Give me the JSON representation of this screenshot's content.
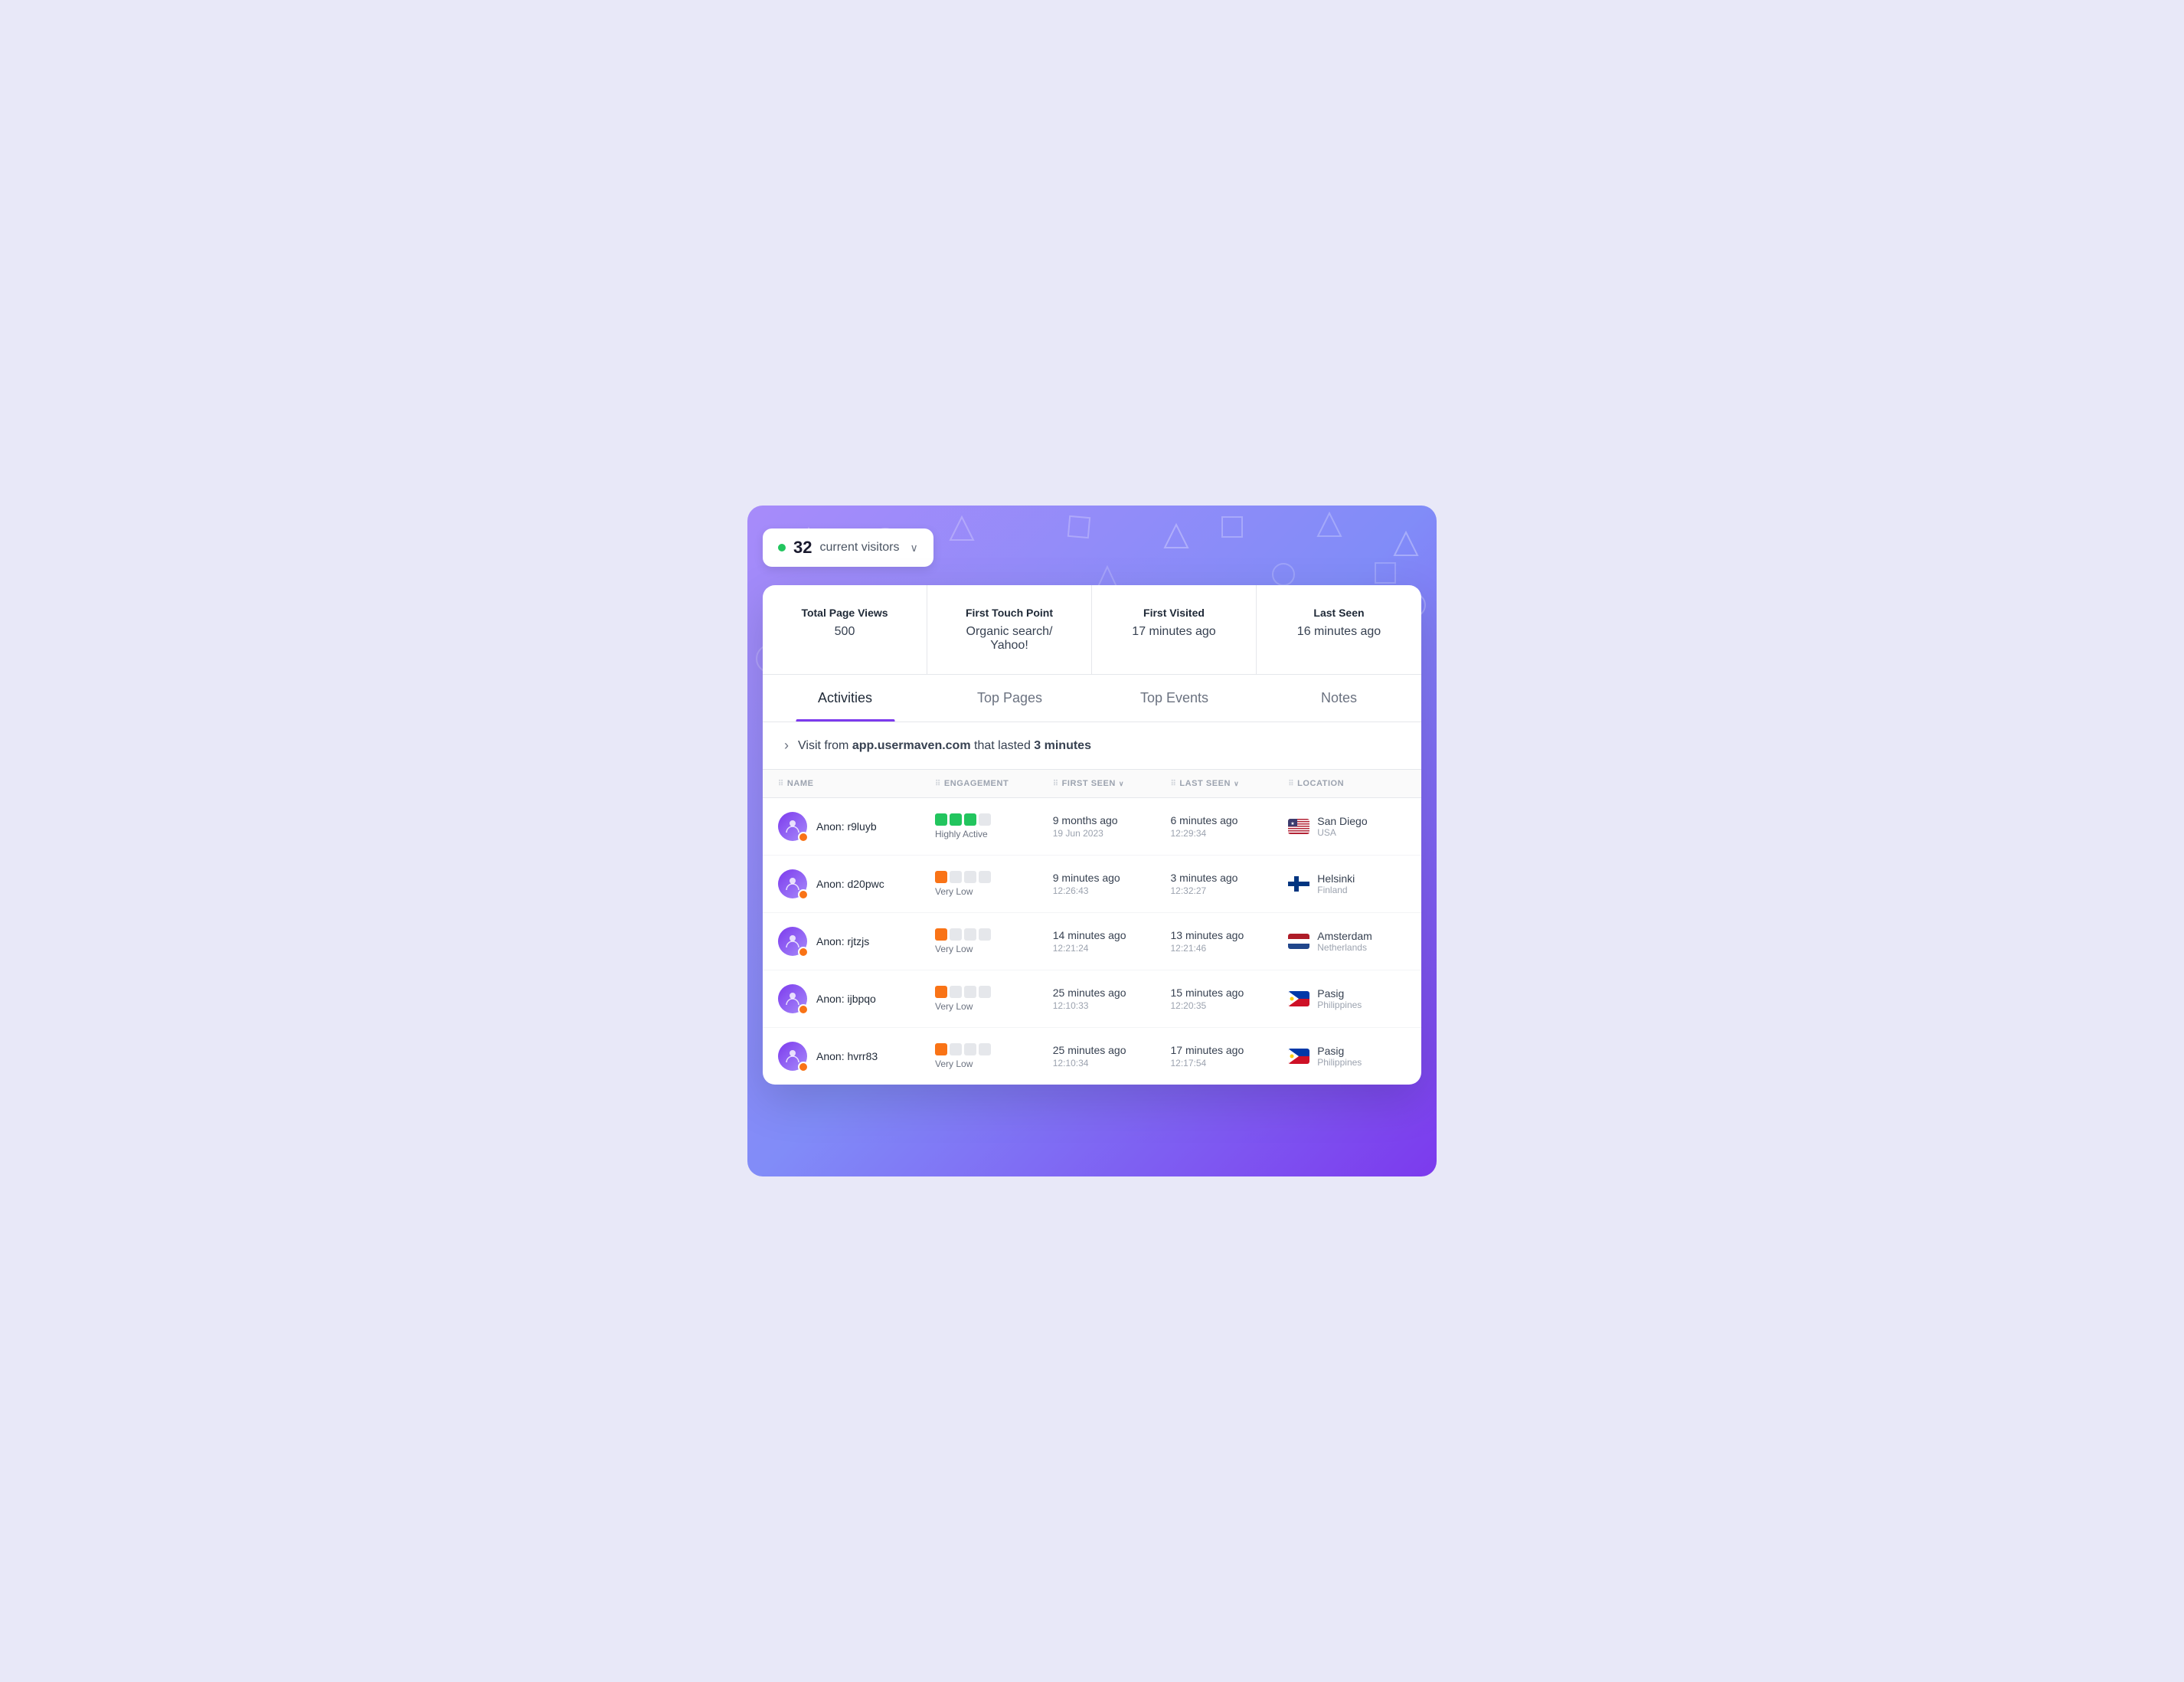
{
  "visitor_pill": {
    "count": "32",
    "label": "current visitors",
    "chevron": "∨"
  },
  "stats": [
    {
      "label": "Total Page Views",
      "value": "500"
    },
    {
      "label": "First Touch Point",
      "value": "Organic search/ Yahoo!"
    },
    {
      "label": "First Visited",
      "value": "17 minutes ago"
    },
    {
      "label": "Last Seen",
      "value": "16 minutes ago"
    }
  ],
  "tabs": [
    {
      "id": "activities",
      "label": "Activities",
      "active": true
    },
    {
      "id": "top-pages",
      "label": "Top Pages",
      "active": false
    },
    {
      "id": "top-events",
      "label": "Top Events",
      "active": false
    },
    {
      "id": "notes",
      "label": "Notes",
      "active": false
    }
  ],
  "visit_banner": {
    "text_prefix": "Visit from ",
    "domain": "app.usermaven.com",
    "text_middle": " that lasted ",
    "duration": "3 minutes"
  },
  "table": {
    "columns": [
      {
        "id": "name",
        "label": "NAME",
        "sortable": false
      },
      {
        "id": "engagement",
        "label": "ENGAGEMENT",
        "sortable": false
      },
      {
        "id": "first_seen",
        "label": "FIRST SEEN",
        "sortable": true
      },
      {
        "id": "last_seen",
        "label": "LAST SEEN",
        "sortable": true
      },
      {
        "id": "location",
        "label": "LOCATION",
        "sortable": false
      }
    ],
    "rows": [
      {
        "name": "Anon: r9luyb",
        "engagement_level": "highly_active",
        "engagement_label": "Highly Active",
        "first_seen_main": "9 months ago",
        "first_seen_sub": "19 Jun 2023",
        "last_seen_main": "6 minutes ago",
        "last_seen_sub": "12:29:34",
        "city": "San Diego",
        "country": "USA",
        "flag": "usa"
      },
      {
        "name": "Anon: d20pwc",
        "engagement_level": "very_low",
        "engagement_label": "Very Low",
        "first_seen_main": "9 minutes ago",
        "first_seen_sub": "12:26:43",
        "last_seen_main": "3 minutes ago",
        "last_seen_sub": "12:32:27",
        "city": "Helsinki",
        "country": "Finland",
        "flag": "fin"
      },
      {
        "name": "Anon: rjtzjs",
        "engagement_level": "very_low",
        "engagement_label": "Very Low",
        "first_seen_main": "14 minutes ago",
        "first_seen_sub": "12:21:24",
        "last_seen_main": "13 minutes ago",
        "last_seen_sub": "12:21:46",
        "city": "Amsterdam",
        "country": "Netherlands",
        "flag": "nld"
      },
      {
        "name": "Anon: ijbpqo",
        "engagement_level": "very_low",
        "engagement_label": "Very Low",
        "first_seen_main": "25 minutes ago",
        "first_seen_sub": "12:10:33",
        "last_seen_main": "15 minutes ago",
        "last_seen_sub": "12:20:35",
        "city": "Pasig",
        "country": "Philippines",
        "flag": "phl"
      },
      {
        "name": "Anon: hvrr83",
        "engagement_level": "very_low",
        "engagement_label": "Very Low",
        "first_seen_main": "25 minutes ago",
        "first_seen_sub": "12:10:34",
        "last_seen_main": "17 minutes ago",
        "last_seen_sub": "12:17:54",
        "city": "Pasig",
        "country": "Philippines",
        "flag": "phl"
      }
    ]
  }
}
